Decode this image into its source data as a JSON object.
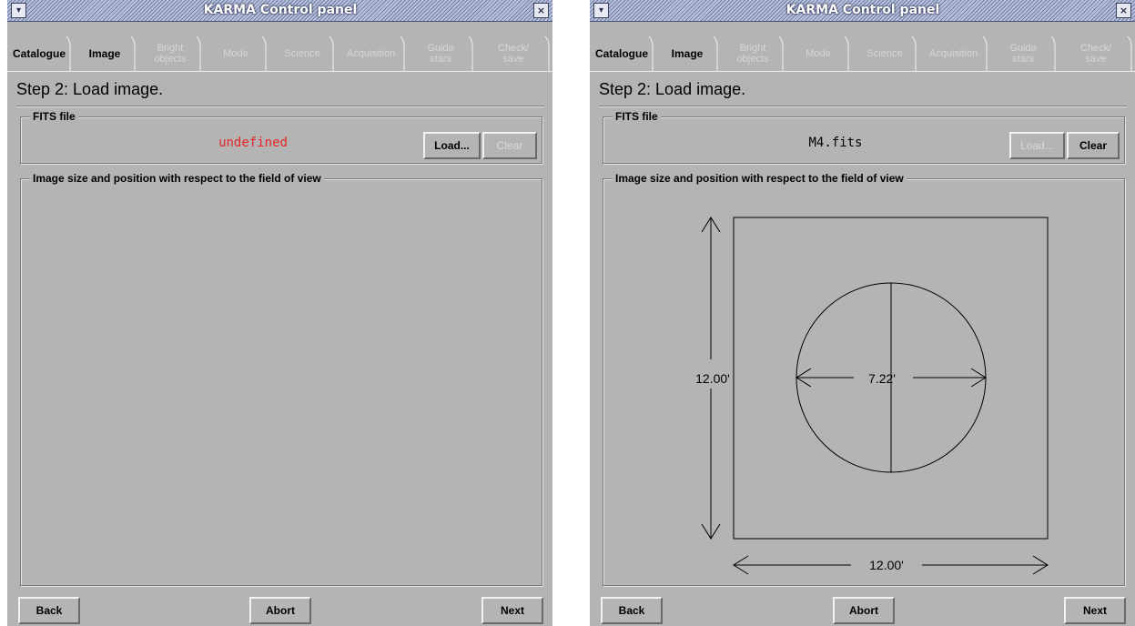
{
  "window_title": "KARMA Control panel",
  "titlebar_icons": {
    "menu": "chevron-down-icon",
    "close": "close-x-icon"
  },
  "tabs": [
    {
      "label": [
        "Catalogue"
      ],
      "enabled": true
    },
    {
      "label": [
        "Image"
      ],
      "enabled": true,
      "active": true
    },
    {
      "label": [
        "Bright",
        "objects"
      ],
      "enabled": false
    },
    {
      "label": [
        "Mode"
      ],
      "enabled": false
    },
    {
      "label": [
        "Science"
      ],
      "enabled": false
    },
    {
      "label": [
        "Acquisition"
      ],
      "enabled": false
    },
    {
      "label": [
        "Guide",
        "stars"
      ],
      "enabled": false
    },
    {
      "label": [
        "Check/",
        "save"
      ],
      "enabled": false
    }
  ],
  "step_title": "Step 2: Load image.",
  "fits_group_label": "FITS file",
  "image_group_label": "Image size and position with respect to the field of view",
  "load_label": "Load...",
  "clear_label": "Clear",
  "back_label": "Back",
  "abort_label": "Abort",
  "next_label": "Next",
  "colors": {
    "panel": "#b4b4b4",
    "undefined_text": "#e8262a"
  },
  "left": {
    "fits_value": "undefined",
    "fits_value_color": "#e8262a",
    "load_enabled": true,
    "clear_enabled": false
  },
  "right": {
    "fits_value": "M4.fits",
    "fits_value_color": "#000000",
    "load_enabled": false,
    "clear_enabled": true,
    "diagram": {
      "image_height_label": "12.00'",
      "image_width_label": "12.00'",
      "fov_diameter_label": "7.22'"
    }
  }
}
